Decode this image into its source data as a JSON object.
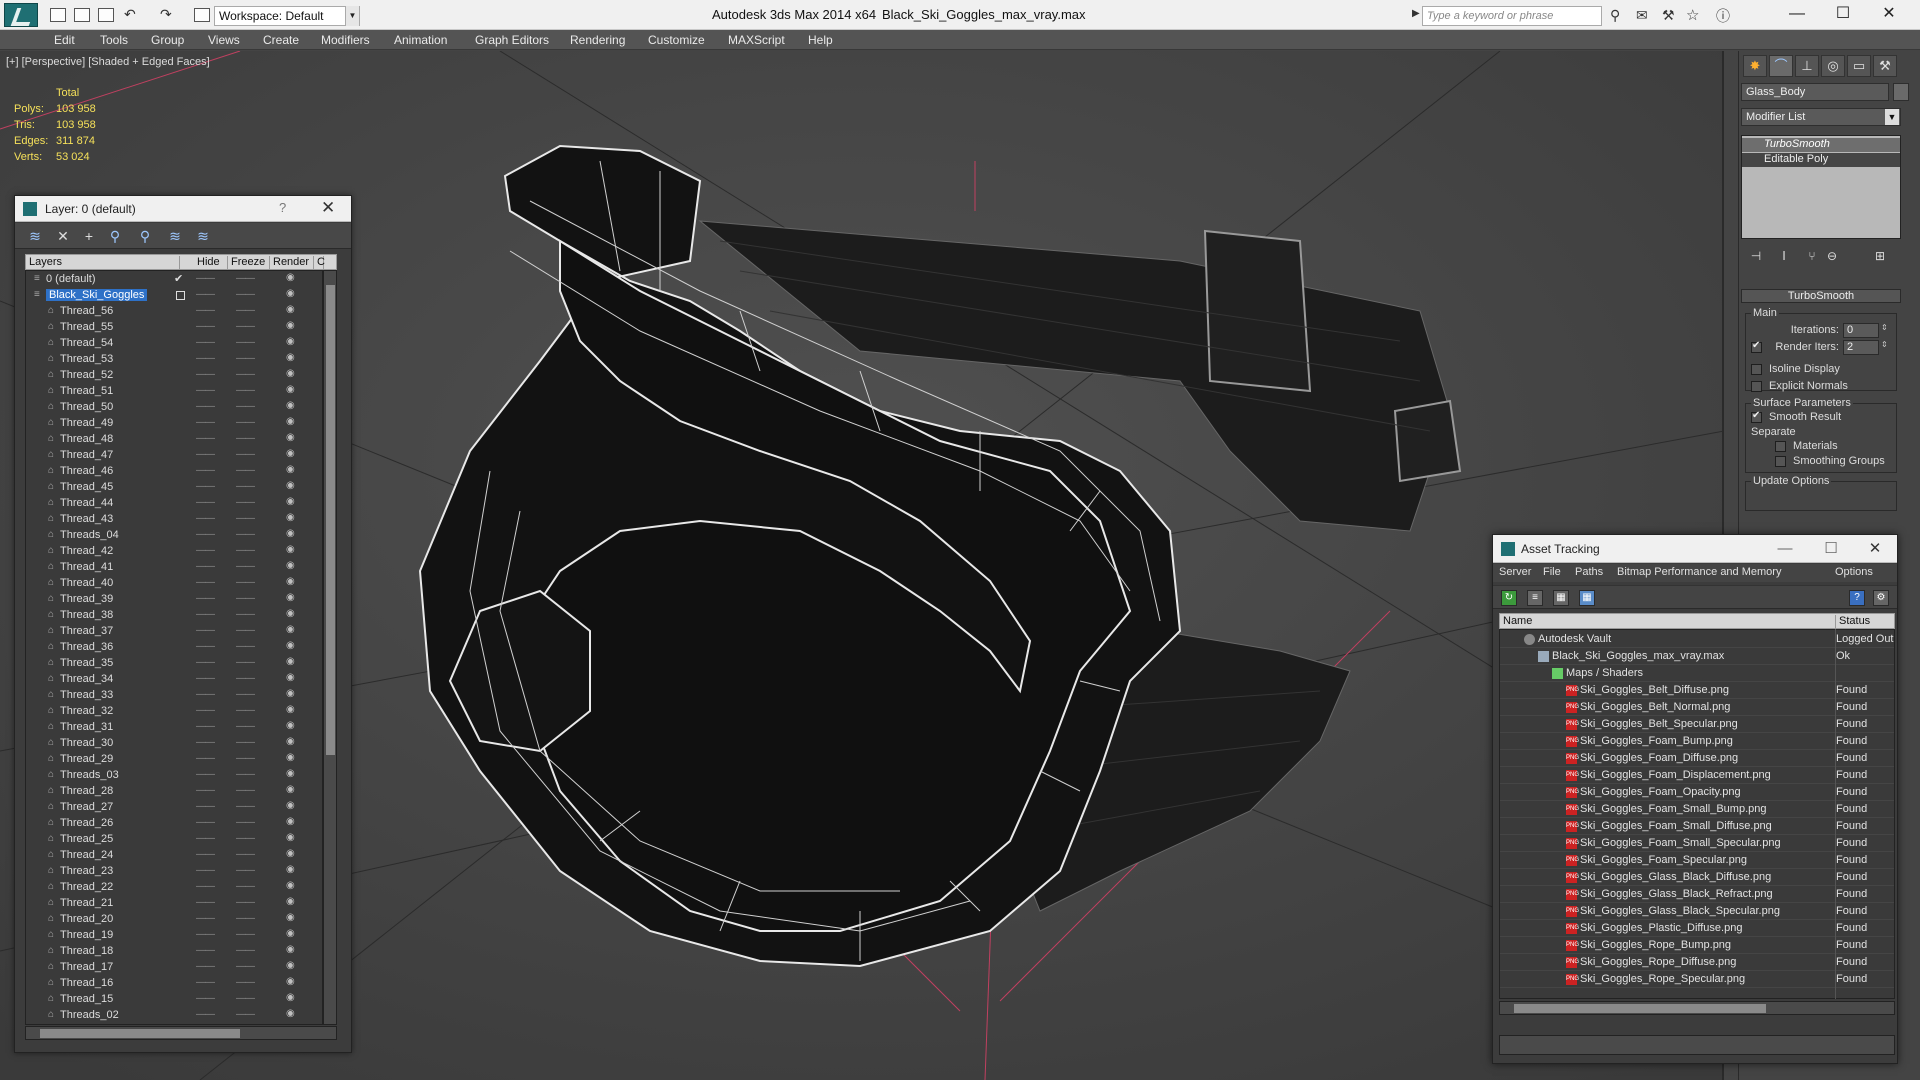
{
  "titlebar": {
    "workspace": "Workspace: Default",
    "app_title": "Autodesk 3ds Max 2014 x64",
    "file_title": "Black_Ski_Goggles_max_vray.max",
    "search_placeholder": "Type a keyword or phrase",
    "minimize": "—",
    "maximize": "☐",
    "close": "✕"
  },
  "menu": [
    "Edit",
    "Tools",
    "Group",
    "Views",
    "Create",
    "Modifiers",
    "Animation",
    "Graph Editors",
    "Rendering",
    "Customize",
    "MAXScript",
    "Help"
  ],
  "viewport": {
    "label": "[+] [Perspective] [Shaded + Edged Faces]",
    "stats": {
      "header": "Total",
      "polys_label": "Polys:",
      "polys": "103 958",
      "tris_label": "Tris:",
      "tris": "103 958",
      "edges_label": "Edges:",
      "edges": "311 874",
      "verts_label": "Verts:",
      "verts": "53 024"
    }
  },
  "layer_dialog": {
    "title": "Layer: 0 (default)",
    "help": "?",
    "close": "✕",
    "columns": {
      "layers": "Layers",
      "hide": "Hide",
      "freeze": "Freeze",
      "render": "Render",
      "extra": "C"
    },
    "rows": [
      "0 (default)",
      "Black_Ski_Goggles",
      "Thread_56",
      "Thread_55",
      "Thread_54",
      "Thread_53",
      "Thread_52",
      "Thread_51",
      "Thread_50",
      "Thread_49",
      "Thread_48",
      "Thread_47",
      "Thread_46",
      "Thread_45",
      "Thread_44",
      "Thread_43",
      "Threads_04",
      "Thread_42",
      "Thread_41",
      "Thread_40",
      "Thread_39",
      "Thread_38",
      "Thread_37",
      "Thread_36",
      "Thread_35",
      "Thread_34",
      "Thread_33",
      "Thread_32",
      "Thread_31",
      "Thread_30",
      "Thread_29",
      "Threads_03",
      "Thread_28",
      "Thread_27",
      "Thread_26",
      "Thread_25",
      "Thread_24",
      "Thread_23",
      "Thread_22",
      "Thread_21",
      "Thread_20",
      "Thread_19",
      "Thread_18",
      "Thread_17",
      "Thread_16",
      "Thread_15",
      "Threads_02"
    ]
  },
  "command_panel": {
    "object_name": "Glass_Body",
    "modifier_list": "Modifier List",
    "stack": [
      "TurboSmooth",
      "Editable Poly"
    ],
    "rollout_title": "TurboSmooth",
    "main_group": "Main",
    "iterations_label": "Iterations:",
    "iterations": "0",
    "render_iters_label": "Render Iters:",
    "render_iters": "2",
    "isoline": "Isoline Display",
    "explicit_normals": "Explicit Normals",
    "surface_group": "Surface Parameters",
    "smooth_result": "Smooth Result",
    "separate": "Separate",
    "materials": "Materials",
    "smoothing_groups": "Smoothing Groups",
    "update_options": "Update Options"
  },
  "asset_tracking": {
    "title": "Asset Tracking",
    "menu": [
      "Server",
      "File",
      "Paths",
      "Bitmap Performance and Memory",
      "Options"
    ],
    "col_name": "Name",
    "col_status": "Status",
    "rows": [
      {
        "name": "Autodesk Vault",
        "status": "Logged Out",
        "indent": 0,
        "icon": "vault"
      },
      {
        "name": "Black_Ski_Goggles_max_vray.max",
        "status": "Ok",
        "indent": 1,
        "icon": "max"
      },
      {
        "name": "Maps / Shaders",
        "status": "",
        "indent": 2,
        "icon": "folder"
      },
      {
        "name": "Ski_Goggles_Belt_Diffuse.png",
        "status": "Found",
        "indent": 3,
        "icon": "png"
      },
      {
        "name": "Ski_Goggles_Belt_Normal.png",
        "status": "Found",
        "indent": 3,
        "icon": "png"
      },
      {
        "name": "Ski_Goggles_Belt_Specular.png",
        "status": "Found",
        "indent": 3,
        "icon": "png"
      },
      {
        "name": "Ski_Goggles_Foam_Bump.png",
        "status": "Found",
        "indent": 3,
        "icon": "png"
      },
      {
        "name": "Ski_Goggles_Foam_Diffuse.png",
        "status": "Found",
        "indent": 3,
        "icon": "png"
      },
      {
        "name": "Ski_Goggles_Foam_Displacement.png",
        "status": "Found",
        "indent": 3,
        "icon": "png"
      },
      {
        "name": "Ski_Goggles_Foam_Opacity.png",
        "status": "Found",
        "indent": 3,
        "icon": "png"
      },
      {
        "name": "Ski_Goggles_Foam_Small_Bump.png",
        "status": "Found",
        "indent": 3,
        "icon": "png"
      },
      {
        "name": "Ski_Goggles_Foam_Small_Diffuse.png",
        "status": "Found",
        "indent": 3,
        "icon": "png"
      },
      {
        "name": "Ski_Goggles_Foam_Small_Specular.png",
        "status": "Found",
        "indent": 3,
        "icon": "png"
      },
      {
        "name": "Ski_Goggles_Foam_Specular.png",
        "status": "Found",
        "indent": 3,
        "icon": "png"
      },
      {
        "name": "Ski_Goggles_Glass_Black_Diffuse.png",
        "status": "Found",
        "indent": 3,
        "icon": "png"
      },
      {
        "name": "Ski_Goggles_Glass_Black_Refract.png",
        "status": "Found",
        "indent": 3,
        "icon": "png"
      },
      {
        "name": "Ski_Goggles_Glass_Black_Specular.png",
        "status": "Found",
        "indent": 3,
        "icon": "png"
      },
      {
        "name": "Ski_Goggles_Plastic_Diffuse.png",
        "status": "Found",
        "indent": 3,
        "icon": "png"
      },
      {
        "name": "Ski_Goggles_Rope_Bump.png",
        "status": "Found",
        "indent": 3,
        "icon": "png"
      },
      {
        "name": "Ski_Goggles_Rope_Diffuse.png",
        "status": "Found",
        "indent": 3,
        "icon": "png"
      },
      {
        "name": "Ski_Goggles_Rope_Specular.png",
        "status": "Found",
        "indent": 3,
        "icon": "png"
      }
    ]
  },
  "colors": {
    "selection": "#2e71c7",
    "stats_text": "#f5e05a",
    "viewport_bg": "#474747"
  }
}
